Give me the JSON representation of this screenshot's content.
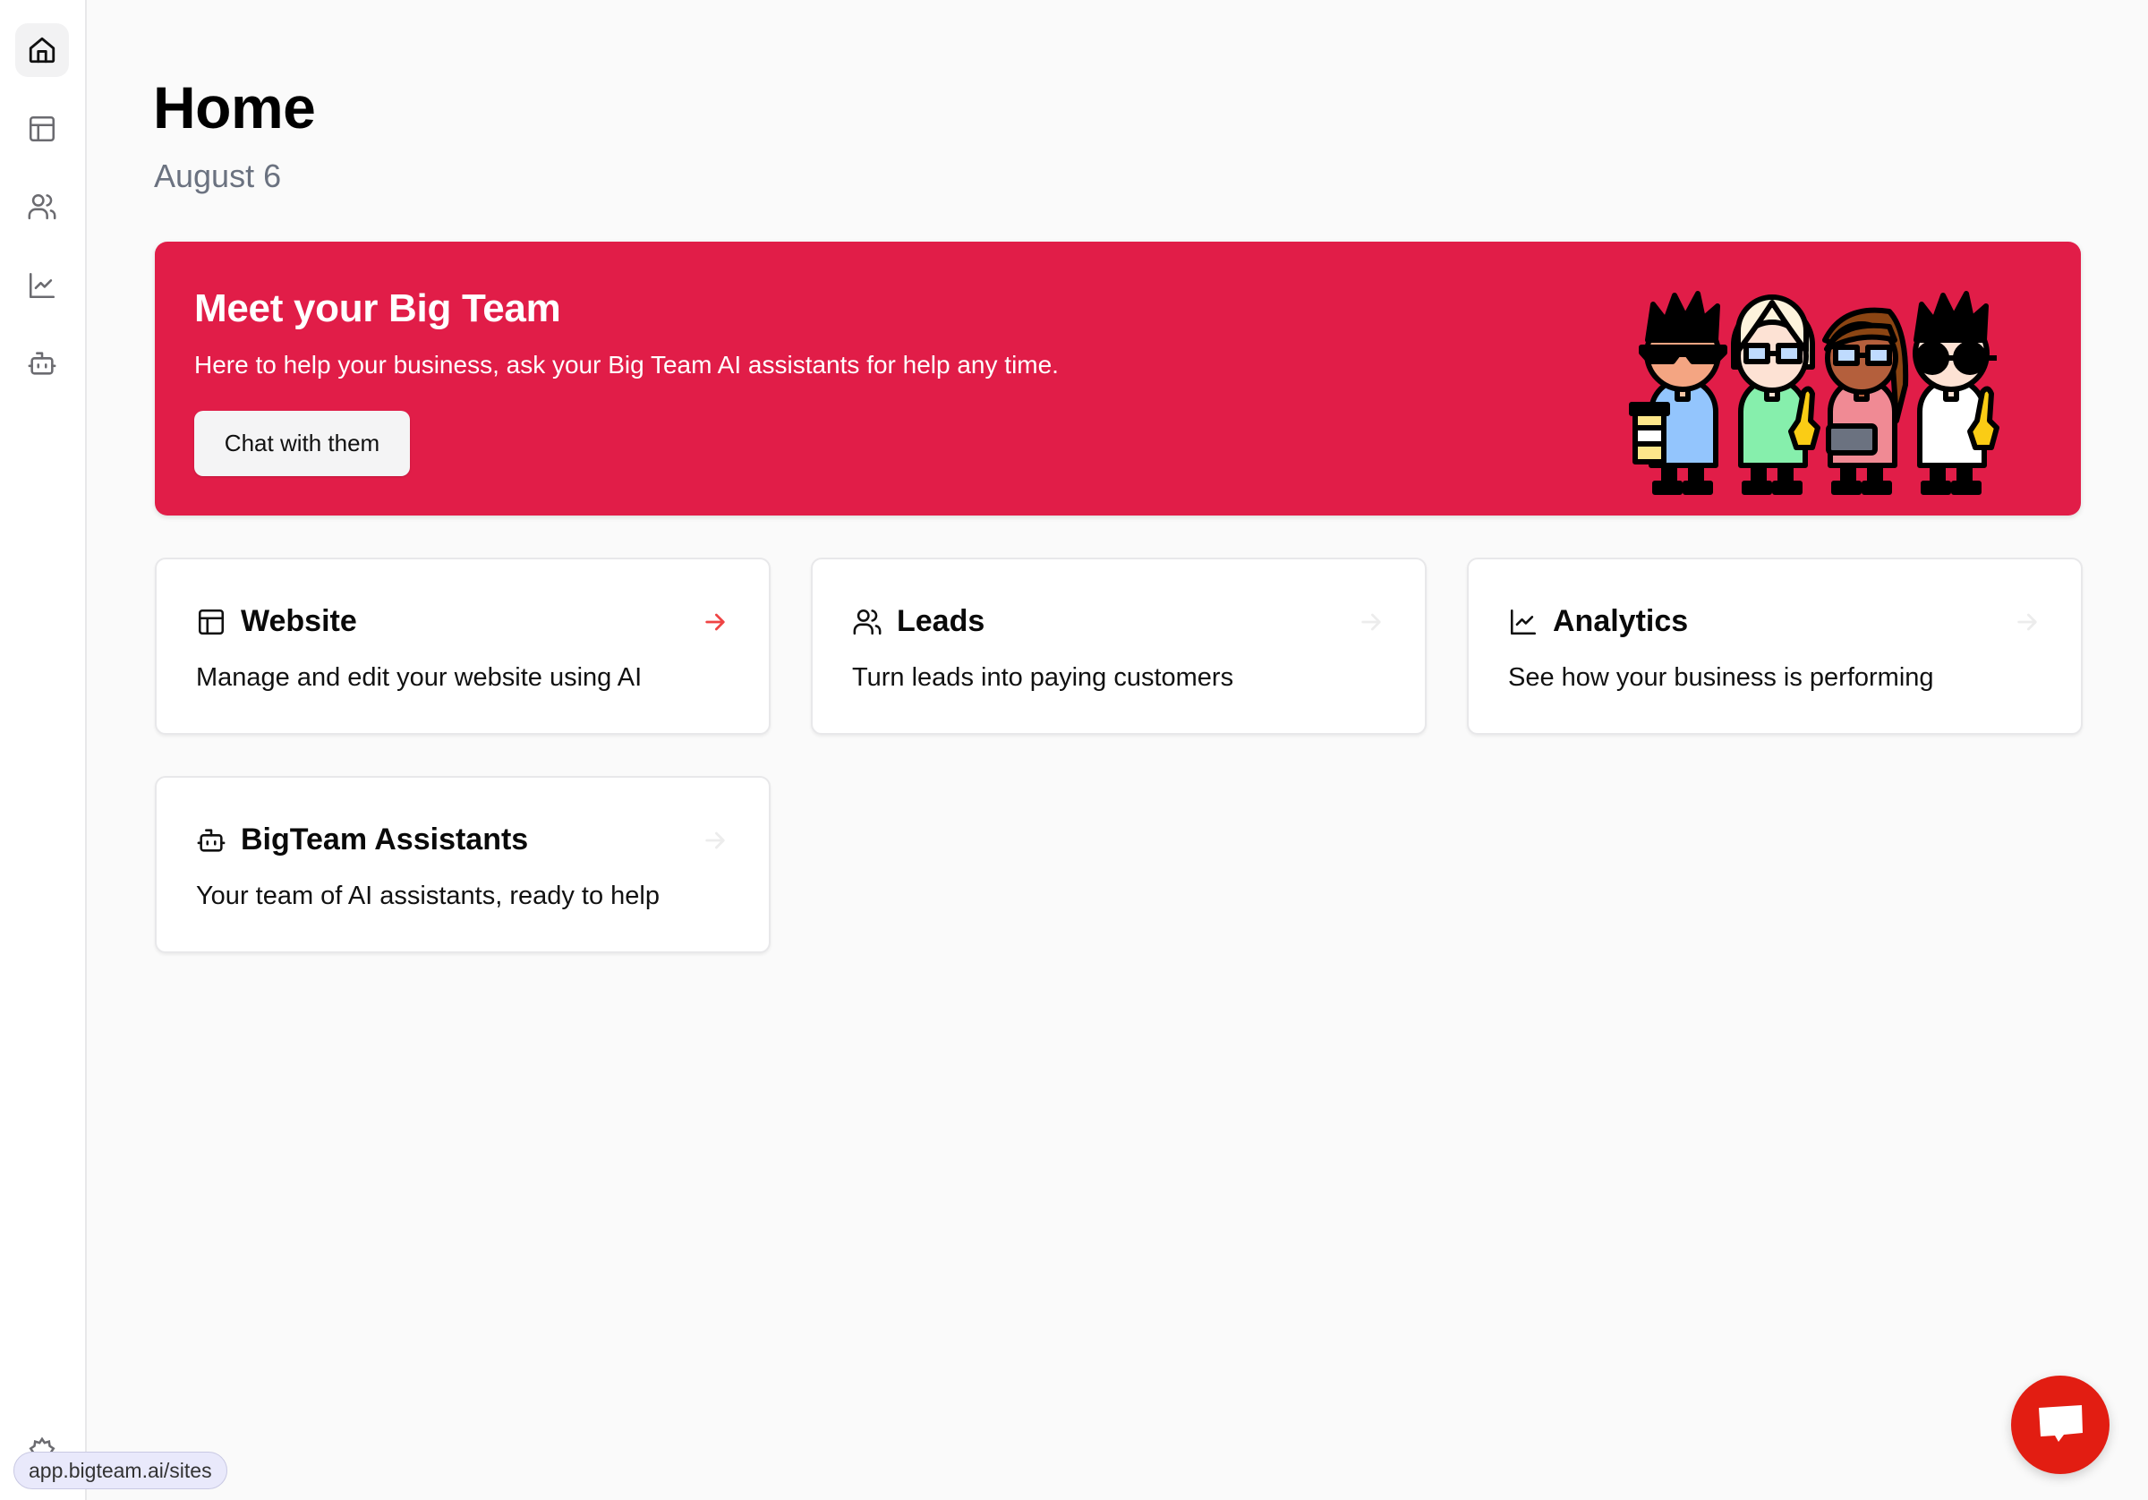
{
  "sidebar": {
    "items": [
      {
        "id": "home",
        "icon": "home-icon",
        "active": true
      },
      {
        "id": "website",
        "icon": "layout-icon",
        "active": false
      },
      {
        "id": "leads",
        "icon": "users-icon",
        "active": false
      },
      {
        "id": "analytics",
        "icon": "chart-line-icon",
        "active": false
      },
      {
        "id": "assistants",
        "icon": "bot-icon",
        "active": false
      }
    ],
    "footer_icon": "settings-icon"
  },
  "header": {
    "title": "Home",
    "date": "August 6"
  },
  "banner": {
    "title": "Meet your Big Team",
    "subtitle": "Here to help your business, ask your Big Team AI assistants for help any time.",
    "button_label": "Chat with them",
    "background_color": "#e11d48",
    "illustration": "four cartoon team members"
  },
  "cards": [
    {
      "id": "website",
      "icon": "layout-icon",
      "title": "Website",
      "description": "Manage and edit your website using AI",
      "arrow_highlighted": true
    },
    {
      "id": "leads",
      "icon": "users-icon",
      "title": "Leads",
      "description": "Turn leads into paying customers",
      "arrow_highlighted": false
    },
    {
      "id": "analytics",
      "icon": "chart-line-icon",
      "title": "Analytics",
      "description": "See how your business is performing",
      "arrow_highlighted": false
    },
    {
      "id": "assistants",
      "icon": "bot-icon",
      "title": "BigTeam Assistants",
      "description": "Your team of AI assistants, ready to help",
      "arrow_highlighted": false
    }
  ],
  "chat_widget": {
    "icon": "chat-bubble-icon",
    "color": "#e21d12"
  },
  "status_bar": {
    "url": "app.bigteam.ai/sites"
  },
  "colors": {
    "accent": "#ef4444",
    "muted_arrow": "#e5e5e5"
  }
}
